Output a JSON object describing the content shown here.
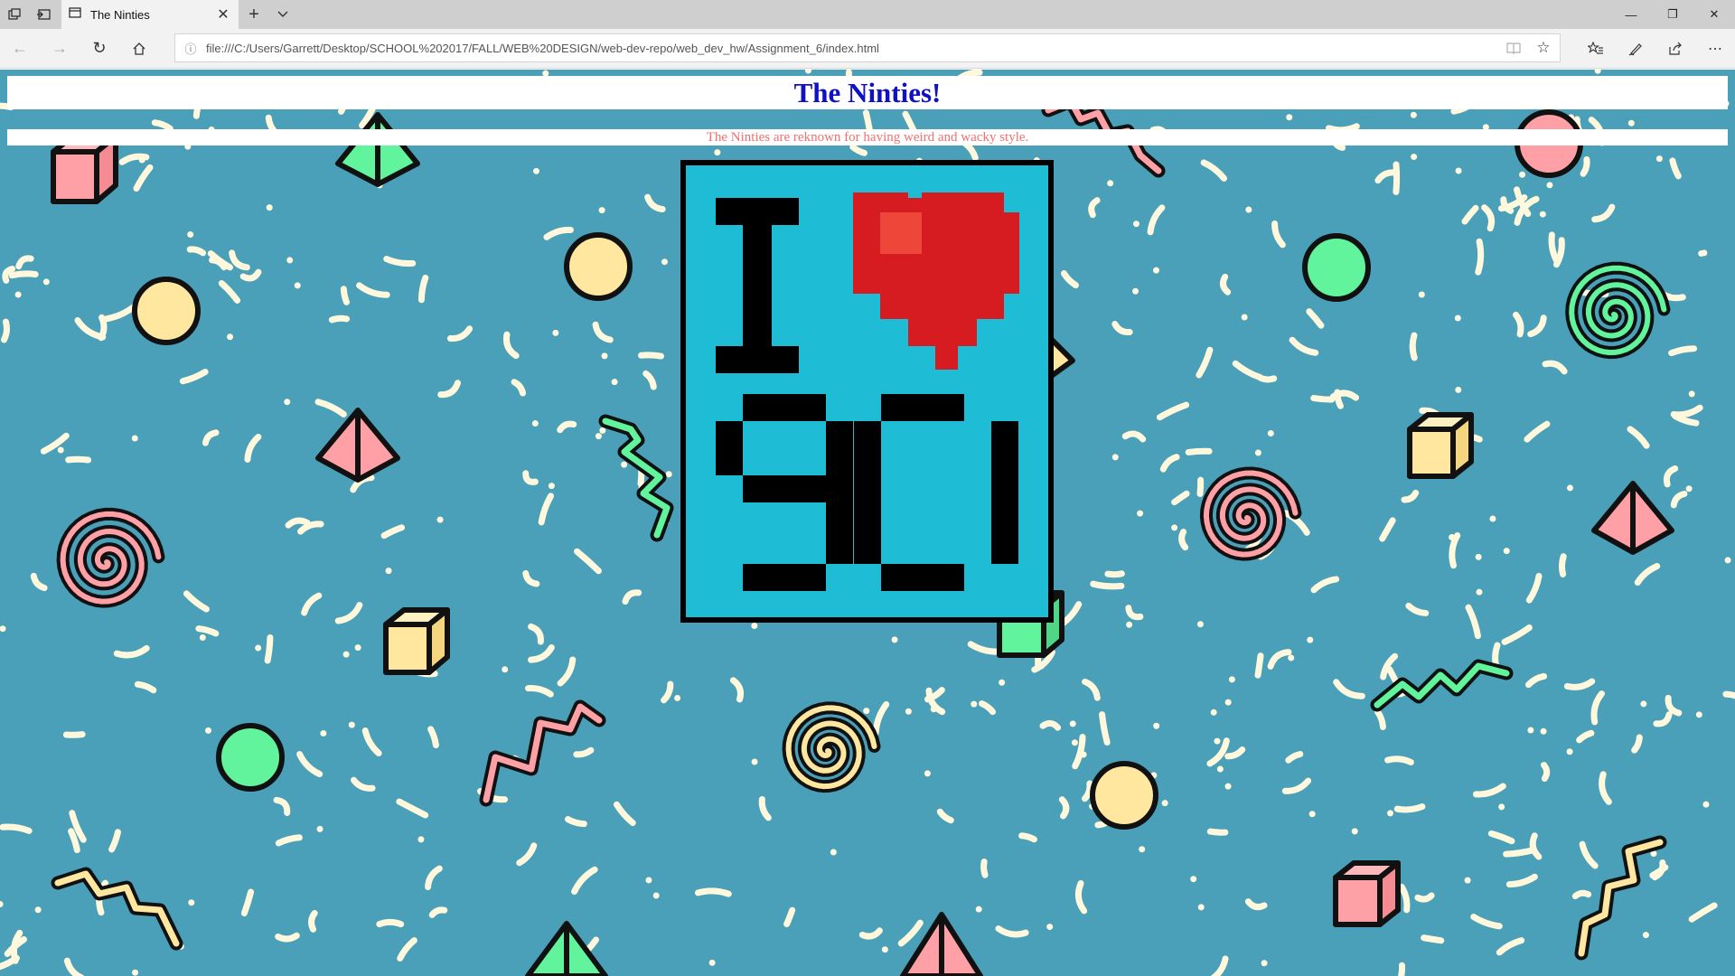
{
  "tab": {
    "title": "The Ninties"
  },
  "address": {
    "url": "file:///C:/Users/Garrett/Desktop/SCHOOL%202017/FALL/WEB%20DESIGN/web-dev-repo/web_dev_hw/Assignment_6/index.html"
  },
  "page": {
    "heading": "The Ninties!",
    "subheading": "The Ninties are reknown for having weird and wacky style."
  },
  "poster": {
    "line1": "I",
    "line2": "90"
  },
  "colors": {
    "background": "#4aa0b9",
    "heading": "#1010c8",
    "subheading": "#f07070",
    "poster_bg": "#1fbcd5",
    "heart": "#d61c20"
  },
  "icons": {
    "tab_actions": "tab-preview-icon",
    "set_aside": "set-aside-tabs-icon",
    "back": "back-arrow-icon",
    "forward": "forward-arrow-icon",
    "refresh": "refresh-icon",
    "home": "home-icon",
    "favorites": "favorites-icon",
    "notes": "pen-icon",
    "share": "share-icon",
    "more": "more-icon"
  }
}
